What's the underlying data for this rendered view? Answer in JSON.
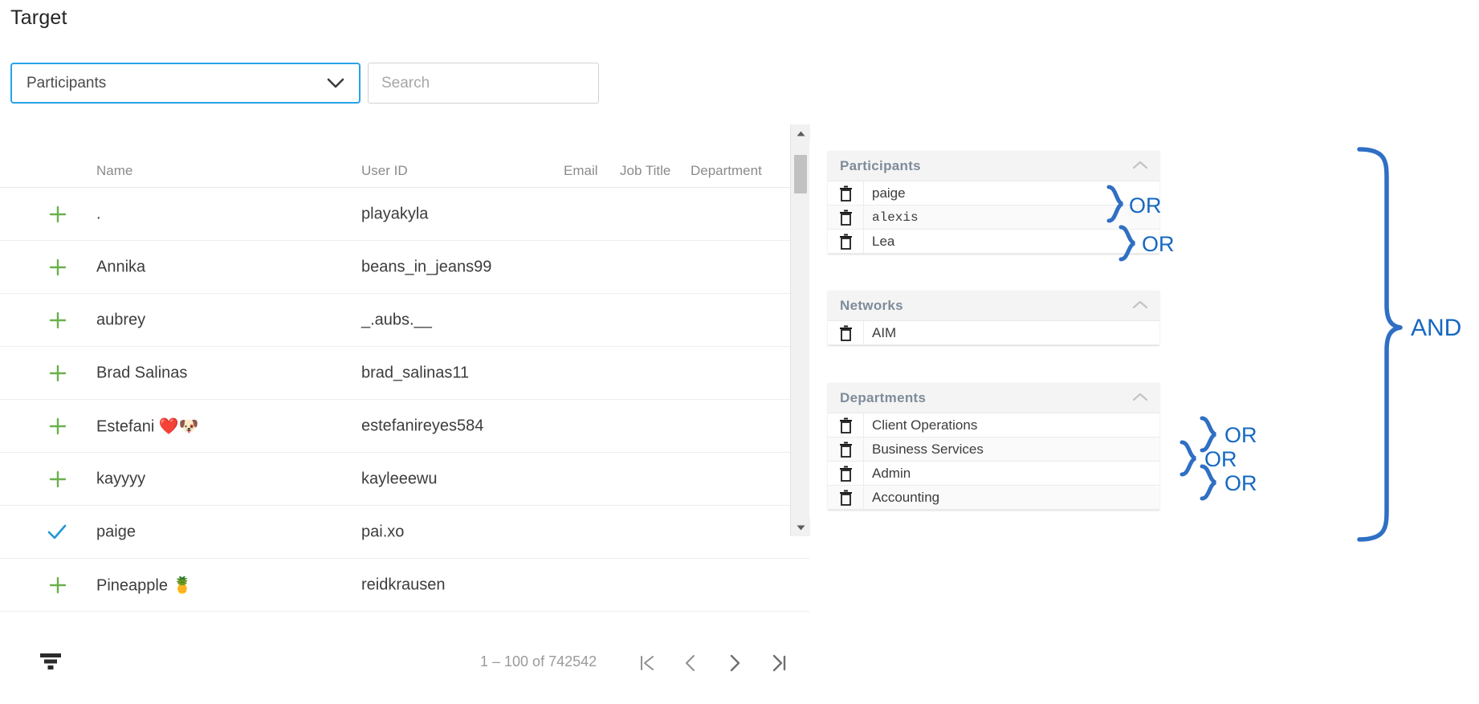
{
  "header": {
    "title": "Target"
  },
  "controls": {
    "select": {
      "value": "Participants",
      "icon": "chevron-down-icon"
    },
    "search": {
      "value": "",
      "placeholder": "Search"
    }
  },
  "table": {
    "columns": [
      "Name",
      "User ID",
      "Email",
      "Job Title",
      "Department"
    ],
    "rows": [
      {
        "action": "add",
        "name": ".",
        "user_id": "playakyla"
      },
      {
        "action": "add",
        "name": "Annika",
        "user_id": "beans_in_jeans99"
      },
      {
        "action": "add",
        "name": "aubrey",
        "user_id": "_.aubs.__"
      },
      {
        "action": "add",
        "name": "Brad Salinas",
        "user_id": "brad_salinas11"
      },
      {
        "action": "add",
        "name": "Estefani ❤️🐶",
        "user_id": "estefanireyes584"
      },
      {
        "action": "add",
        "name": "kayyyy",
        "user_id": "kayleeewu"
      },
      {
        "action": "selected",
        "name": "paige",
        "user_id": "pai.xo"
      },
      {
        "action": "add",
        "name": "Pineapple 🍍",
        "user_id": "reidkrausen"
      }
    ]
  },
  "footer": {
    "filter_icon": "filter-list-icon",
    "page_count": "1 – 100 of 742542",
    "first_page_icon": "first-page-icon",
    "prev_page_icon": "previous-page-icon",
    "next_page_icon": "next-page-icon",
    "last_page_icon": "last-page-icon"
  },
  "filter_panels": [
    {
      "title": "Participants",
      "collapse_icon": "chevron-up-icon",
      "items": [
        {
          "label": "paige",
          "mono": false,
          "delete_icon": "trash-icon"
        },
        {
          "label": "alexis",
          "mono": true,
          "delete_icon": "trash-icon"
        },
        {
          "label": "Lea",
          "mono": false,
          "delete_icon": "trash-icon"
        }
      ]
    },
    {
      "title": "Networks",
      "collapse_icon": "chevron-up-icon",
      "items": [
        {
          "label": "AIM",
          "mono": false,
          "delete_icon": "trash-icon"
        }
      ]
    },
    {
      "title": "Departments",
      "collapse_icon": "chevron-up-icon",
      "items": [
        {
          "label": "Client Operations",
          "mono": false,
          "delete_icon": "trash-icon"
        },
        {
          "label": "Business Services",
          "mono": false,
          "delete_icon": "trash-icon"
        },
        {
          "label": "Admin",
          "mono": false,
          "delete_icon": "trash-icon"
        },
        {
          "label": "Accounting",
          "mono": false,
          "delete_icon": "trash-icon"
        }
      ]
    }
  ],
  "annotations": {
    "color": "#1668c1",
    "and_label": "AND",
    "or_labels": [
      "OR",
      "OR",
      "OR",
      "OR",
      "OR"
    ]
  },
  "colors": {
    "accent_blue": "#29a3e8",
    "annotation_blue": "#1668c1",
    "add_green": "#6ab04c",
    "check_blue": "#2196d3",
    "panel_header_text": "#7e8c9a"
  }
}
